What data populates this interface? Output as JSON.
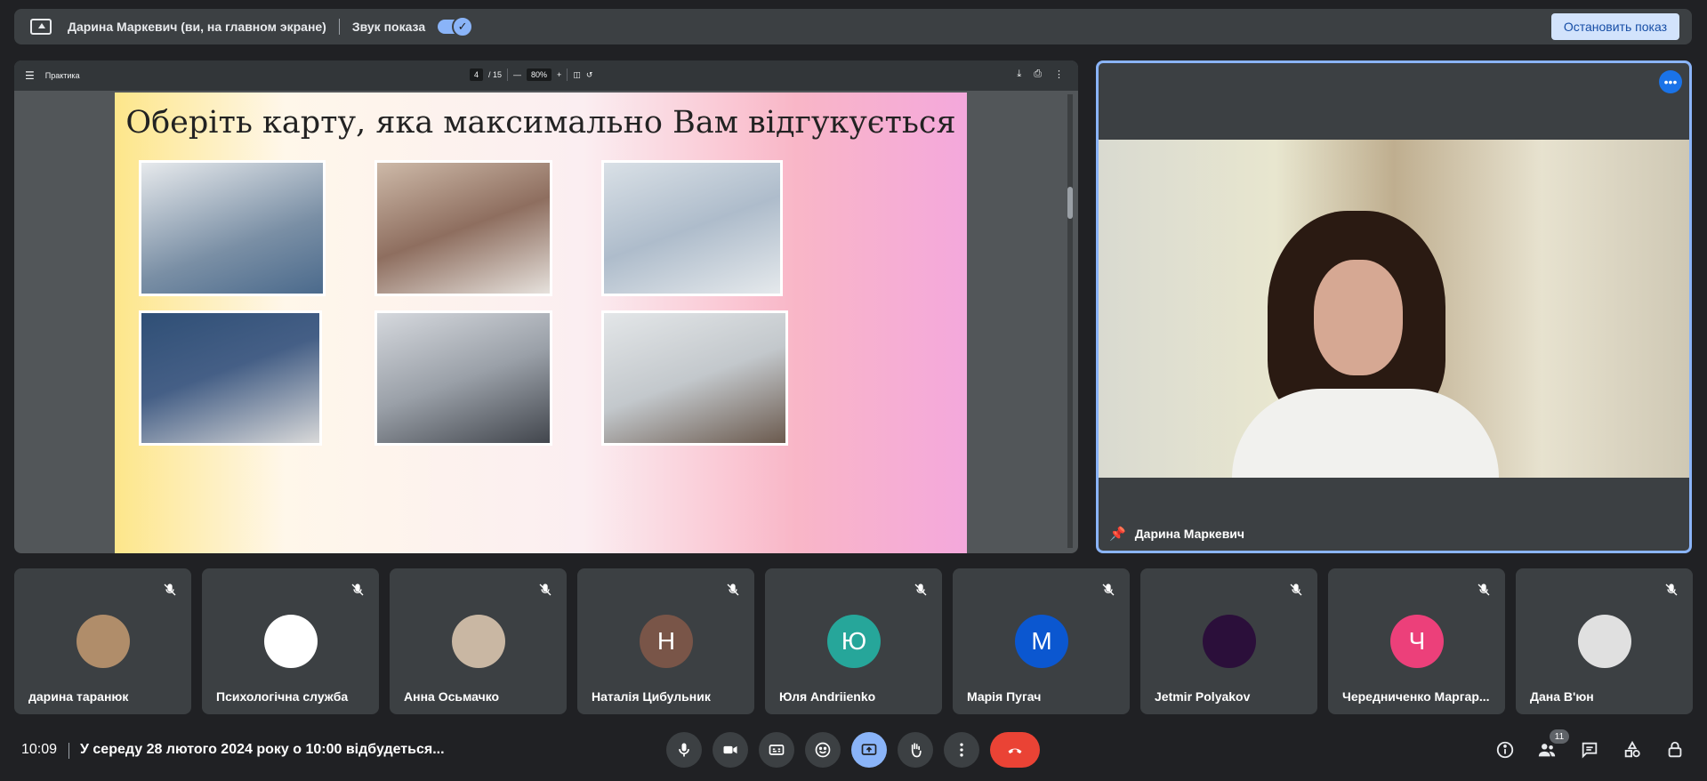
{
  "banner": {
    "presenter_label": "Дарина Маркевич (ви, на главном экране)",
    "sound_label": "Звук показа",
    "stop_button": "Остановить показ"
  },
  "pdf_viewer": {
    "doc_title": "Практика",
    "page_current": "4",
    "page_total": "/ 15",
    "zoom": "80%",
    "slide_title": "Оберіть карту, яка максимально Вам відгукується",
    "cards": [
      "card-1",
      "card-2",
      "card-3",
      "card-4",
      "card-5",
      "card-6"
    ]
  },
  "speaker": {
    "name": "Дарина Маркевич"
  },
  "participants": [
    {
      "name": "дарина таранюк",
      "initial": "",
      "color": "#b08d6a"
    },
    {
      "name": "Психологічна служба",
      "initial": "",
      "color": "#ffffff"
    },
    {
      "name": "Анна Осьмачко",
      "initial": "",
      "color": "#c9b7a3"
    },
    {
      "name": "Наталія Цибульник",
      "initial": "Н",
      "color": "#795548"
    },
    {
      "name": "Юля Andriienko",
      "initial": "Ю",
      "color": "#26a69a"
    },
    {
      "name": "Марія Пугач",
      "initial": "М",
      "color": "#0b57d0"
    },
    {
      "name": "Jetmir Polyakov",
      "initial": "",
      "color": "#2b0f3a"
    },
    {
      "name": "Чередниченко Маргар...",
      "initial": "Ч",
      "color": "#ec407a"
    },
    {
      "name": "Дана В'юн",
      "initial": "",
      "color": "#e0e0e0"
    }
  ],
  "bottom_bar": {
    "time": "10:09",
    "meeting_title": "У середу 28 лютого 2024 року о 10:00 відбудеться...",
    "participants_count": "11"
  }
}
